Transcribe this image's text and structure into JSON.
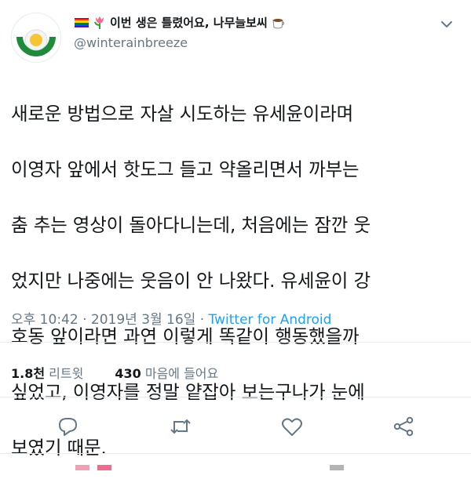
{
  "tweet": {
    "display_name": "이번 생은 틀렸어요, 나무늘보씨",
    "handle": "@winterainbreeze",
    "text_lines": [
      "새로운 방법으로 자살 시도하는 유세윤이라며",
      "이영자 앞에서 핫도그 들고 약올리면서 까부는",
      "춤 추는 영상이 돌아다니는데, 처음에는 잠깐 웃",
      "었지만 나중에는 웃음이 안 나왔다. 유세윤이 강",
      "호동 앞이라면 과연 이렇게 똑같이 행동했을까",
      "싶었고, 이영자를 정말 얕잡아 보는구나가 눈에",
      "보였기 때문."
    ],
    "timestamp": "오후 10:42 · 2019년 3월 16일 · ",
    "source": "Twitter for Android",
    "retweet_count": "1.8천",
    "retweet_label": "리트윗",
    "like_count": "430",
    "like_label": "마음에 들어요"
  },
  "icons": {
    "name_prefix": [
      "rainbow-flag-icon",
      "tulip-icon"
    ],
    "name_suffix": "coffee-icon",
    "menu": "chevron-down-icon",
    "actions": [
      "reply-icon",
      "retweet-icon",
      "like-icon",
      "share-icon"
    ]
  },
  "colors": {
    "text": "#14171a",
    "secondary": "#657786",
    "link": "#1da1f2",
    "divider": "#e6ecf0",
    "avatar_green": "#1e8a3c",
    "avatar_yellow": "#f6c533"
  }
}
